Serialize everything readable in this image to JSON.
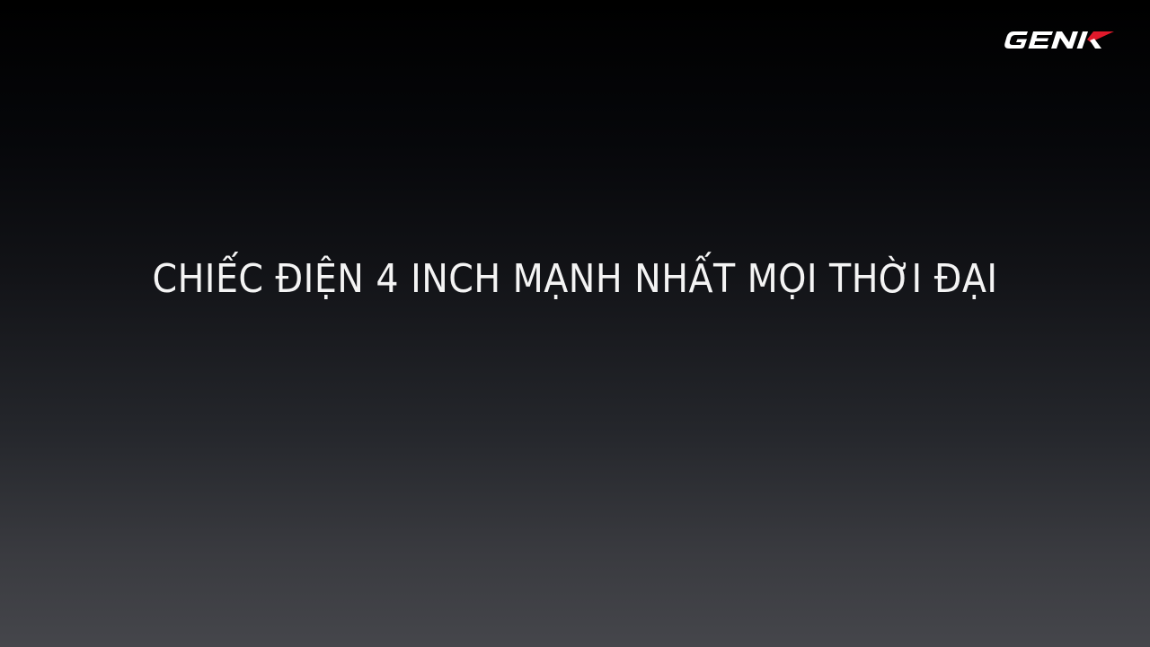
{
  "overlay": {
    "logo_text": "GENK",
    "headline": "CHIẾC ĐIỆN 4 INCH MẠNH NHẤT MỌI THỜI ĐẠI"
  },
  "colors": {
    "background_top": "#000000",
    "background_bottom": "#45464b",
    "headline_text": "#f4f4f4",
    "logo_white": "#ffffff",
    "logo_red": "#e0192b"
  },
  "icons": {
    "logo": "genk-logo"
  }
}
